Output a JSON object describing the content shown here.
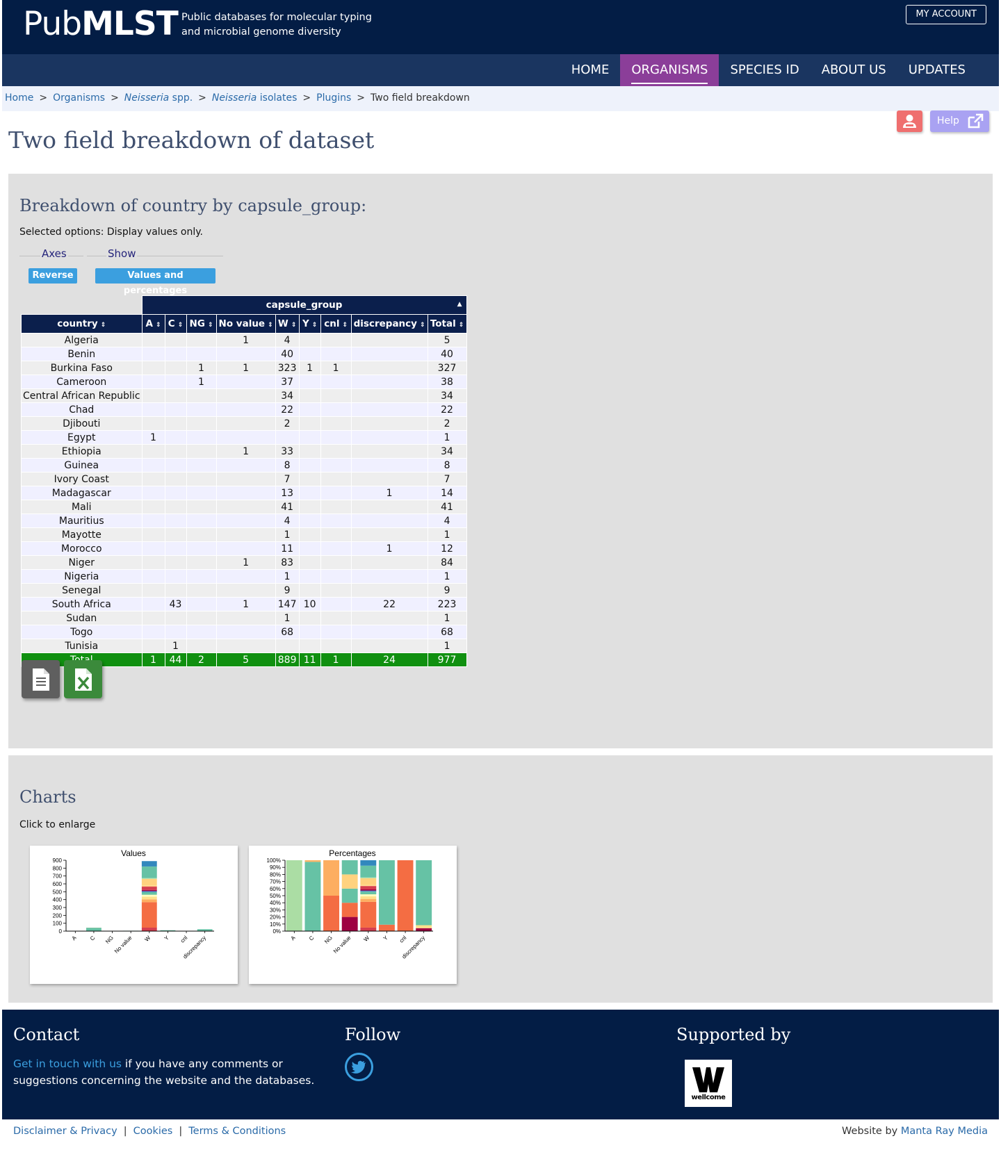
{
  "header": {
    "logo_light": "Pub",
    "logo_bold": "MLST",
    "tagline_line1": "Public databases for molecular typing",
    "tagline_line2": "and microbial genome diversity",
    "account_label": "MY ACCOUNT"
  },
  "nav": [
    {
      "label": "HOME",
      "active": false
    },
    {
      "label": "ORGANISMS",
      "active": true
    },
    {
      "label": "SPECIES ID",
      "active": false
    },
    {
      "label": "ABOUT US",
      "active": false
    },
    {
      "label": "UPDATES",
      "active": false
    }
  ],
  "breadcrumb": {
    "home": "Home",
    "organisms": "Organisms",
    "species_italic": "Neisseria",
    "species_rest": " spp.",
    "isolates_italic": "Neisseria",
    "isolates_rest": " isolates",
    "plugins": "Plugins",
    "current": "Two field breakdown",
    "separator": ">"
  },
  "help_label": "Help",
  "page_title": "Two field breakdown of dataset",
  "breakdown": {
    "heading": "Breakdown of country by capsule_group:",
    "options_text": "Selected options: Display values only.",
    "axes_legend": "Axes",
    "show_legend": "Show",
    "reverse_label": "Reverse",
    "values_percent_label": "Values and percentages",
    "group_header": "capsule_group",
    "columns": [
      "country",
      "A",
      "C",
      "NG",
      "No value",
      "W",
      "Y",
      "cnl",
      "discrepancy",
      "Total"
    ],
    "rows": [
      [
        "Algeria",
        "",
        "",
        "",
        "1",
        "4",
        "",
        "",
        "",
        "5"
      ],
      [
        "Benin",
        "",
        "",
        "",
        "",
        "40",
        "",
        "",
        "",
        "40"
      ],
      [
        "Burkina Faso",
        "",
        "",
        "1",
        "1",
        "323",
        "1",
        "1",
        "",
        "327"
      ],
      [
        "Cameroon",
        "",
        "",
        "1",
        "",
        "37",
        "",
        "",
        "",
        "38"
      ],
      [
        "Central African Republic",
        "",
        "",
        "",
        "",
        "34",
        "",
        "",
        "",
        "34"
      ],
      [
        "Chad",
        "",
        "",
        "",
        "",
        "22",
        "",
        "",
        "",
        "22"
      ],
      [
        "Djibouti",
        "",
        "",
        "",
        "",
        "2",
        "",
        "",
        "",
        "2"
      ],
      [
        "Egypt",
        "1",
        "",
        "",
        "",
        "",
        "",
        "",
        "",
        "1"
      ],
      [
        "Ethiopia",
        "",
        "",
        "",
        "1",
        "33",
        "",
        "",
        "",
        "34"
      ],
      [
        "Guinea",
        "",
        "",
        "",
        "",
        "8",
        "",
        "",
        "",
        "8"
      ],
      [
        "Ivory Coast",
        "",
        "",
        "",
        "",
        "7",
        "",
        "",
        "",
        "7"
      ],
      [
        "Madagascar",
        "",
        "",
        "",
        "",
        "13",
        "",
        "",
        "1",
        "14"
      ],
      [
        "Mali",
        "",
        "",
        "",
        "",
        "41",
        "",
        "",
        "",
        "41"
      ],
      [
        "Mauritius",
        "",
        "",
        "",
        "",
        "4",
        "",
        "",
        "",
        "4"
      ],
      [
        "Mayotte",
        "",
        "",
        "",
        "",
        "1",
        "",
        "",
        "",
        "1"
      ],
      [
        "Morocco",
        "",
        "",
        "",
        "",
        "11",
        "",
        "",
        "1",
        "12"
      ],
      [
        "Niger",
        "",
        "",
        "",
        "1",
        "83",
        "",
        "",
        "",
        "84"
      ],
      [
        "Nigeria",
        "",
        "",
        "",
        "",
        "1",
        "",
        "",
        "",
        "1"
      ],
      [
        "Senegal",
        "",
        "",
        "",
        "",
        "9",
        "",
        "",
        "",
        "9"
      ],
      [
        "South Africa",
        "",
        "43",
        "",
        "1",
        "147",
        "10",
        "",
        "22",
        "223"
      ],
      [
        "Sudan",
        "",
        "",
        "",
        "",
        "1",
        "",
        "",
        "",
        "1"
      ],
      [
        "Togo",
        "",
        "",
        "",
        "",
        "68",
        "",
        "",
        "",
        "68"
      ],
      [
        "Tunisia",
        "",
        "1",
        "",
        "",
        "",
        "",
        "",
        "",
        "1"
      ]
    ],
    "total_row": [
      "Total",
      "1",
      "44",
      "2",
      "5",
      "889",
      "11",
      "1",
      "24",
      "977"
    ],
    "colors": {
      "header": "#0b1f4c",
      "total": "#109010",
      "pill": "#3b9fdf"
    }
  },
  "charts": {
    "heading": "Charts",
    "hint": "Click to enlarge",
    "values_title": "Values",
    "percentages_title": "Percentages",
    "categories": [
      "A",
      "C",
      "NG",
      "No value",
      "W",
      "Y",
      "cnl",
      "discrepancy"
    ],
    "values_ticks": [
      "0",
      "100",
      "200",
      "300",
      "400",
      "500",
      "600",
      "700",
      "800",
      "900"
    ],
    "percent_ticks": [
      "0%",
      "10%",
      "20%",
      "30%",
      "40%",
      "50%",
      "60%",
      "70%",
      "80%",
      "90%",
      "100%"
    ]
  },
  "chart_data": [
    {
      "type": "bar",
      "stacked": true,
      "title": "Values",
      "categories": [
        "A",
        "C",
        "NG",
        "No value",
        "W",
        "Y",
        "cnl",
        "discrepancy"
      ],
      "ylim": [
        0,
        900
      ],
      "series": [
        {
          "name": "Algeria",
          "values": [
            0,
            0,
            0,
            1,
            4,
            0,
            0,
            0
          ]
        },
        {
          "name": "Benin",
          "values": [
            0,
            0,
            0,
            0,
            40,
            0,
            0,
            0
          ]
        },
        {
          "name": "Burkina Faso",
          "values": [
            0,
            0,
            1,
            1,
            323,
            1,
            1,
            0
          ]
        },
        {
          "name": "Cameroon",
          "values": [
            0,
            0,
            1,
            0,
            37,
            0,
            0,
            0
          ]
        },
        {
          "name": "Central African Republic",
          "values": [
            0,
            0,
            0,
            0,
            34,
            0,
            0,
            0
          ]
        },
        {
          "name": "Chad",
          "values": [
            0,
            0,
            0,
            0,
            22,
            0,
            0,
            0
          ]
        },
        {
          "name": "Djibouti",
          "values": [
            0,
            0,
            0,
            0,
            2,
            0,
            0,
            0
          ]
        },
        {
          "name": "Egypt",
          "values": [
            1,
            0,
            0,
            0,
            0,
            0,
            0,
            0
          ]
        },
        {
          "name": "Ethiopia",
          "values": [
            0,
            0,
            0,
            1,
            33,
            0,
            0,
            0
          ]
        },
        {
          "name": "Guinea",
          "values": [
            0,
            0,
            0,
            0,
            8,
            0,
            0,
            0
          ]
        },
        {
          "name": "Ivory Coast",
          "values": [
            0,
            0,
            0,
            0,
            7,
            0,
            0,
            0
          ]
        },
        {
          "name": "Madagascar",
          "values": [
            0,
            0,
            0,
            0,
            13,
            0,
            0,
            1
          ]
        },
        {
          "name": "Mali",
          "values": [
            0,
            0,
            0,
            0,
            41,
            0,
            0,
            0
          ]
        },
        {
          "name": "Mauritius",
          "values": [
            0,
            0,
            0,
            0,
            4,
            0,
            0,
            0
          ]
        },
        {
          "name": "Mayotte",
          "values": [
            0,
            0,
            0,
            0,
            1,
            0,
            0,
            0
          ]
        },
        {
          "name": "Morocco",
          "values": [
            0,
            0,
            0,
            0,
            11,
            0,
            0,
            1
          ]
        },
        {
          "name": "Niger",
          "values": [
            0,
            0,
            0,
            1,
            83,
            0,
            0,
            0
          ]
        },
        {
          "name": "Nigeria",
          "values": [
            0,
            0,
            0,
            0,
            1,
            0,
            0,
            0
          ]
        },
        {
          "name": "Senegal",
          "values": [
            0,
            0,
            0,
            0,
            9,
            0,
            0,
            0
          ]
        },
        {
          "name": "South Africa",
          "values": [
            0,
            43,
            0,
            1,
            147,
            10,
            0,
            22
          ]
        },
        {
          "name": "Sudan",
          "values": [
            0,
            0,
            0,
            0,
            1,
            0,
            0,
            0
          ]
        },
        {
          "name": "Togo",
          "values": [
            0,
            0,
            0,
            0,
            68,
            0,
            0,
            0
          ]
        },
        {
          "name": "Tunisia",
          "values": [
            0,
            1,
            0,
            0,
            0,
            0,
            0,
            0
          ]
        }
      ]
    },
    {
      "type": "bar",
      "stacked": true,
      "normalized": true,
      "title": "Percentages",
      "categories": [
        "A",
        "C",
        "NG",
        "No value",
        "W",
        "Y",
        "cnl",
        "discrepancy"
      ],
      "ylim": [
        0,
        100
      ]
    }
  ],
  "series_colors": [
    "#9e0142",
    "#d53e4f",
    "#f46d43",
    "#fdae61",
    "#fee08b",
    "#ffffbf",
    "#e6f598",
    "#abdda4",
    "#66c2a5",
    "#3288bd",
    "#5e4fa2",
    "#9e0142",
    "#d53e4f",
    "#f46d43",
    "#fdae61",
    "#fee08b",
    "#ffd27f",
    "#e6f598",
    "#abdda4",
    "#66c2a5",
    "#4aa3b8",
    "#3288bd",
    "#fdb462"
  ],
  "footer": {
    "contact_title": "Contact",
    "contact_link": "Get in touch with us",
    "contact_text": " if you have any comments or suggestions concerning the website and the databases.",
    "follow_title": "Follow",
    "supported_title": "Supported by",
    "wellcome_text": "wellcome",
    "disclaimer": "Disclaimer & Privacy",
    "cookies": "Cookies",
    "terms": "Terms & Conditions",
    "website_by": "Website by ",
    "website_by_link": "Manta Ray Media"
  }
}
